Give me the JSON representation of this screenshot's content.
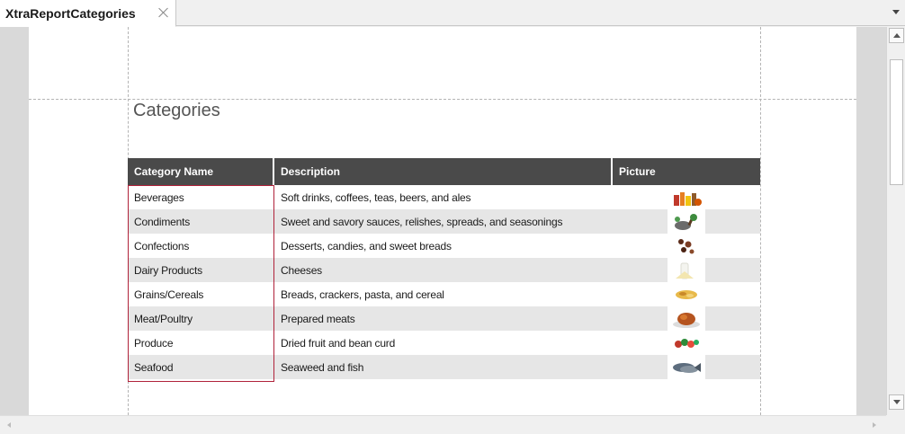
{
  "tab": {
    "title": "XtraReportCategories",
    "close_icon": "close-icon",
    "menu_icon": "chevron-down-icon"
  },
  "report": {
    "title": "Categories",
    "columns": [
      "Category Name",
      "Description",
      "Picture"
    ],
    "rows": [
      {
        "name": "Beverages",
        "description": "Soft drinks, coffees, teas, beers, and ales",
        "picture": "beverages-image"
      },
      {
        "name": "Condiments",
        "description": "Sweet and savory sauces, relishes, spreads, and seasonings",
        "picture": "condiments-image"
      },
      {
        "name": "Confections",
        "description": "Desserts, candies, and sweet breads",
        "picture": "confections-image"
      },
      {
        "name": "Dairy Products",
        "description": "Cheeses",
        "picture": "dairy-image"
      },
      {
        "name": "Grains/Cereals",
        "description": "Breads, crackers, pasta, and cereal",
        "picture": "grains-image"
      },
      {
        "name": "Meat/Poultry",
        "description": "Prepared meats",
        "picture": "meat-image"
      },
      {
        "name": "Produce",
        "description": "Dried fruit and bean curd",
        "picture": "produce-image"
      },
      {
        "name": "Seafood",
        "description": "Seaweed and fish",
        "picture": "seafood-image"
      }
    ]
  },
  "colors": {
    "header_bg": "#4a4a4a",
    "alt_row": "#e6e6e6",
    "selection": "#b0223a",
    "title": "#555555"
  }
}
